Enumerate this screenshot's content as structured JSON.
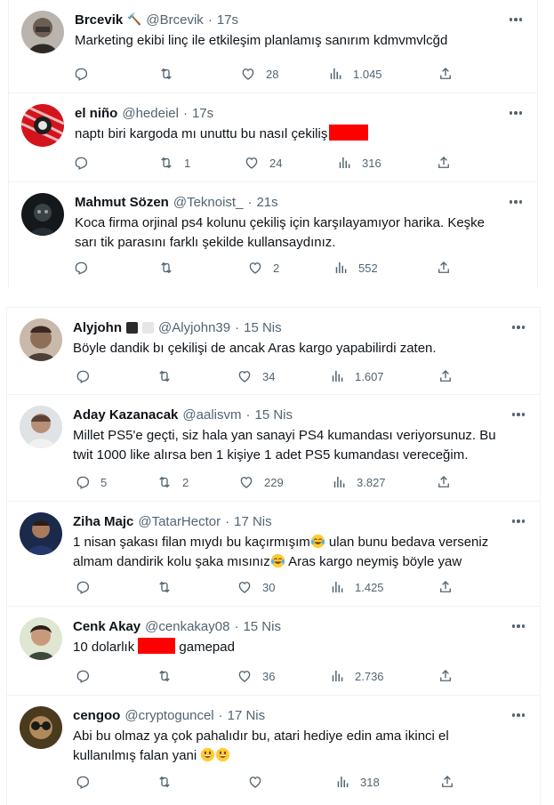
{
  "tweets": [
    {
      "name": "Brcevik",
      "badge": "🔨",
      "handle": "@Brcevik",
      "time": "17s",
      "text": "Marketing ekibi linç ile etkileşim planlamış sanırım kdmvmvlcğd",
      "reply": "",
      "retweet": "",
      "like": "28",
      "views": "1.045"
    },
    {
      "name": "el niño",
      "handle": "@hedeiel",
      "time": "17s",
      "text": "naptı biri kargoda mı unuttu bu nasıl çekiliş",
      "reply": "",
      "retweet": "1",
      "like": "24",
      "views": "316"
    },
    {
      "name": "Mahmut Sözen",
      "handle": "@Teknoist_",
      "time": "21s",
      "text": "Koca firma orjinal ps4 kolunu çekiliş için karşılayamıyor harika. Keşke sarı tik parasını farklı şekilde kullansaydınız.",
      "reply": "",
      "retweet": "",
      "like": "2",
      "views": "552"
    },
    {
      "name": "Alyjohn",
      "handle": "@Alyjohn39",
      "time": "15 Nis",
      "text": "Böyle dandik bı çekilişi de ancak Aras kargo yapabilirdi zaten.",
      "reply": "",
      "retweet": "",
      "like": "34",
      "views": "1.607"
    },
    {
      "name": "Aday Kazanacak",
      "handle": "@aalisvm",
      "time": "15 Nis",
      "text": "Millet PS5'e geçti, siz hala yan sanayi PS4 kumandası veriyorsunuz. Bu twit 1000 like alırsa ben 1 kişiye 1 adet PS5 kumandası vereceğim.",
      "reply": "5",
      "retweet": "2",
      "like": "229",
      "views": "3.827"
    },
    {
      "name": "Ziha Majc",
      "handle": "@TatarHector",
      "time": "17 Nis",
      "text_1": "1 nisan şakası filan mıydı bu kaçırmışım",
      "text_2": " ulan bunu bedava verseniz almam dandirik kolu şaka mısınız",
      "text_3": " Aras kargo neymiş böyle yaw",
      "reply": "",
      "retweet": "",
      "like": "30",
      "views": "1.425"
    },
    {
      "name": "Cenk Akay",
      "handle": "@cenkakay08",
      "time": "15 Nis",
      "text_1": "10 dolarlık",
      "text_2": " gamepad",
      "reply": "",
      "retweet": "",
      "like": "36",
      "views": "2.736"
    },
    {
      "name": "cengoo",
      "handle": "@cryptoguncel",
      "time": "17 Nis",
      "text": "Abi bu olmaz ya çok pahalıdır bu, atari hediye edin ama ikinci el kullanılmış falan yani",
      "reply": "",
      "retweet": "",
      "like": "",
      "views": "318"
    }
  ],
  "separator": "·",
  "colors": {
    "text": "#0f1419",
    "secondary": "#536471",
    "border": "#eff3f4",
    "redaction": "#ff0000"
  },
  "icons": [
    "reply-icon",
    "retweet-icon",
    "like-icon",
    "views-icon",
    "share-icon",
    "more-icon"
  ]
}
